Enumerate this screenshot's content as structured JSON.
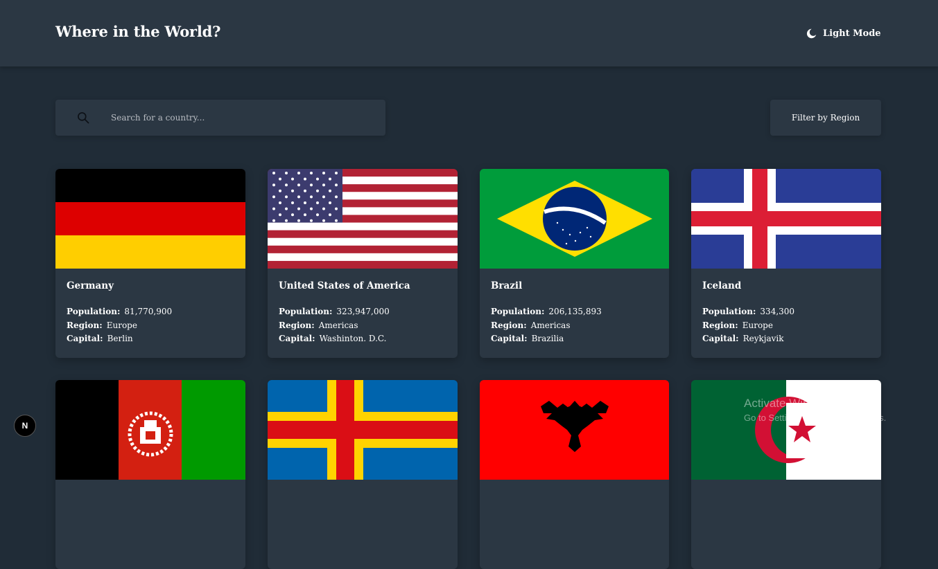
{
  "header": {
    "title": "Where in the World?",
    "mode_label": "Light Mode",
    "mode_icon": "moon-icon"
  },
  "search": {
    "placeholder": "Search for a country...",
    "value": "",
    "icon": "search-icon"
  },
  "filter": {
    "label": "Filter by Region"
  },
  "labels": {
    "population": "Population:",
    "region": "Region:",
    "capital": "Capital:"
  },
  "countries": [
    {
      "name": "Germany",
      "population": "81,770,900",
      "region": "Europe",
      "capital": "Berlin",
      "flag": "germany-flag"
    },
    {
      "name": "United States of America",
      "population": "323,947,000",
      "region": "Americas",
      "capital": "Washinton. D.C.",
      "flag": "usa-flag"
    },
    {
      "name": "Brazil",
      "population": "206,135,893",
      "region": "Americas",
      "capital": "Brazilia",
      "flag": "brazil-flag"
    },
    {
      "name": "Iceland",
      "population": "334,300",
      "region": "Europe",
      "capital": "Reykjavik",
      "flag": "iceland-flag"
    },
    {
      "flag": "afghanistan-flag"
    },
    {
      "flag": "aland-flag"
    },
    {
      "flag": "albania-flag"
    },
    {
      "flag": "algeria-flag"
    }
  ],
  "watermark": {
    "line1": "Activate Windows",
    "line2": "Go to Settings to activate Windows."
  },
  "dev_badge": "N",
  "colors": {
    "background": "#202c37",
    "elements": "#2b3743",
    "text": "#ffffff"
  }
}
